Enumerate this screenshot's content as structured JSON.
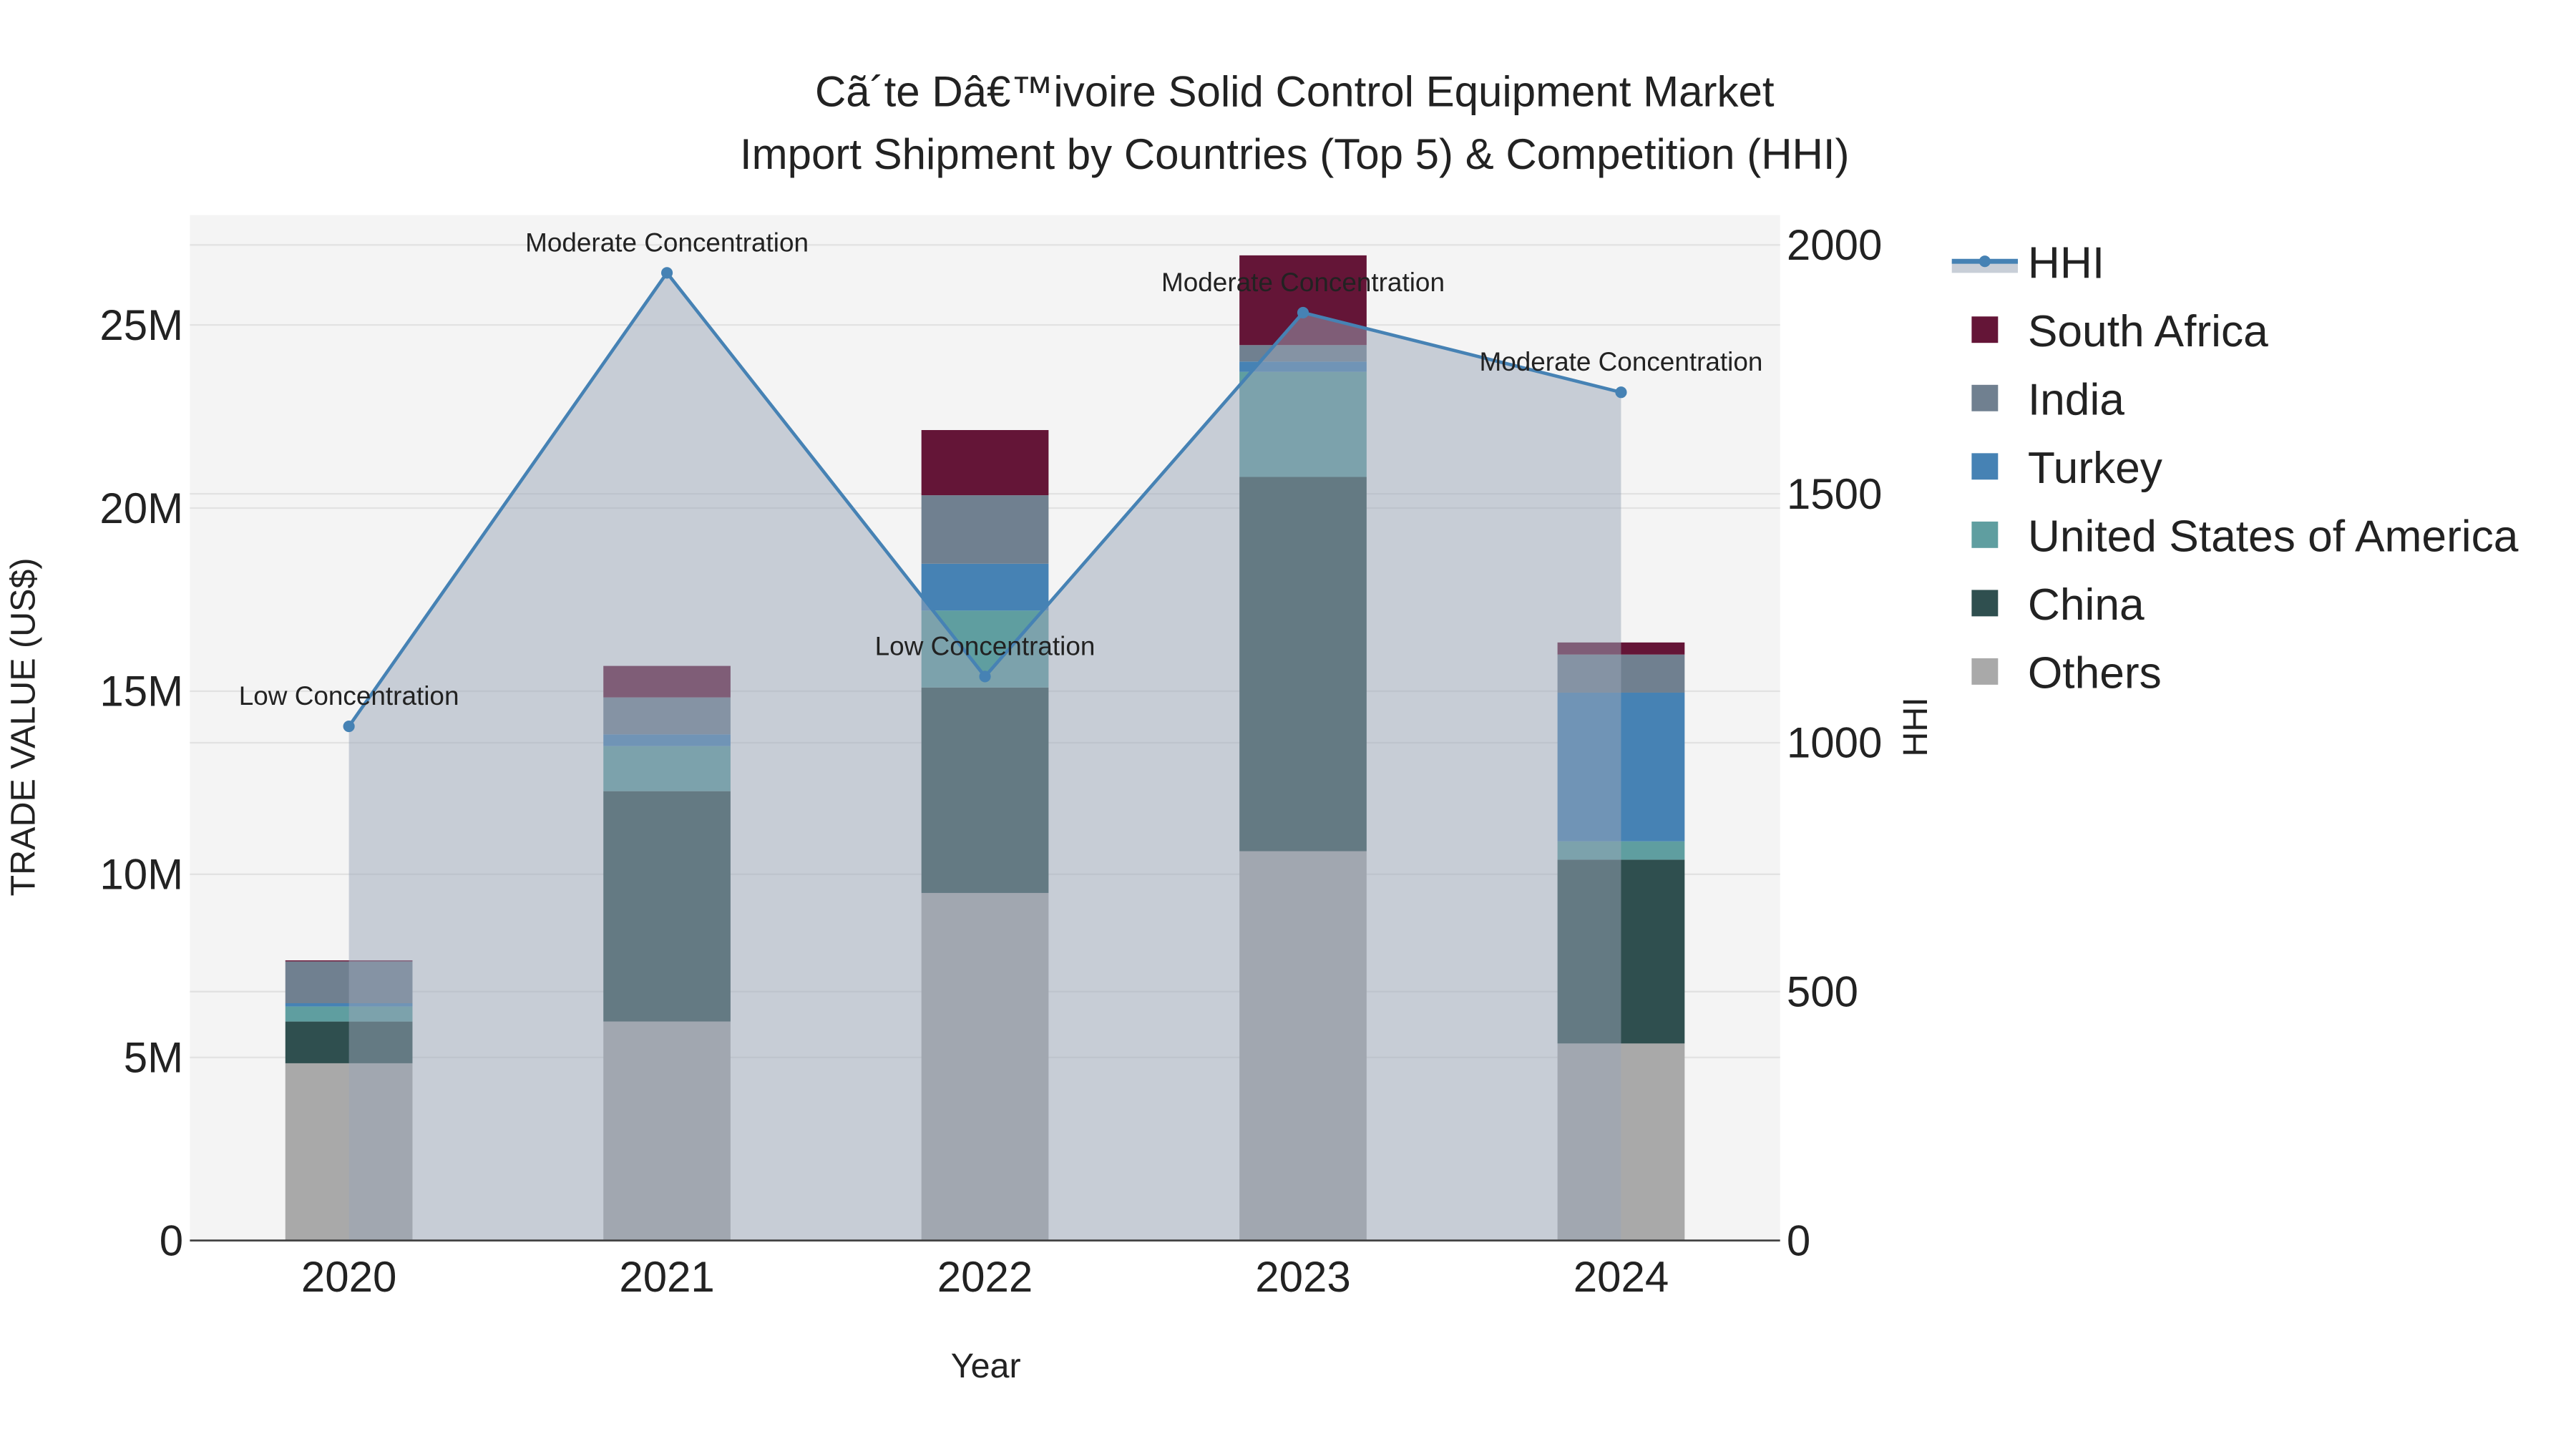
{
  "chart_data": {
    "type": "bar",
    "title_line1": "Cã´te Dâ€™ivoire Solid Control Equipment Market",
    "title_line2": "Import Shipment by Countries (Top 5) & Competition (HHI)",
    "xlabel": "Year",
    "ylabel": "TRADE VALUE (US$)",
    "y2label": "HHI",
    "categories": [
      "2020",
      "2021",
      "2022",
      "2023",
      "2024"
    ],
    "ylim": [
      0,
      28000000
    ],
    "y_ticks": [
      0,
      5000000,
      10000000,
      15000000,
      20000000,
      25000000
    ],
    "y_tick_labels": [
      "0",
      "5M",
      "10M",
      "15M",
      "20M",
      "25M"
    ],
    "y2lim": [
      0,
      2060
    ],
    "y2_ticks": [
      0,
      500,
      1000,
      1500,
      2000
    ],
    "y2_tick_labels": [
      "0",
      "500",
      "1000",
      "1500",
      "2000"
    ],
    "grid": true,
    "legend_position": "right",
    "series": [
      {
        "name": "Others",
        "color": "#a9a9a9",
        "values": [
          4840000,
          5980000,
          9490000,
          10630000,
          5380000
        ]
      },
      {
        "name": "China",
        "color": "#2f4f4f",
        "values": [
          1140000,
          6290000,
          5610000,
          10220000,
          5020000
        ]
      },
      {
        "name": "United States of America",
        "color": "#5f9ea0",
        "values": [
          410000,
          1230000,
          2100000,
          2870000,
          500000
        ]
      },
      {
        "name": "Turkey",
        "color": "#4682b4",
        "values": [
          90000,
          320000,
          1280000,
          280000,
          4060000
        ]
      },
      {
        "name": "India",
        "color": "#708090",
        "values": [
          1140000,
          1010000,
          1870000,
          450000,
          1040000
        ]
      },
      {
        "name": "South Africa",
        "color": "#641537",
        "values": [
          30000,
          860000,
          1780000,
          2450000,
          330000
        ]
      }
    ],
    "hhi": {
      "name": "HHI",
      "color": "#4682b4",
      "values": [
        1033,
        1944,
        1133,
        1864,
        1704
      ],
      "annotations": [
        "Low Concentration",
        "Moderate Concentration",
        "Low Concentration",
        "Moderate Concentration",
        "Moderate Concentration"
      ]
    },
    "legend_order": [
      "HHI",
      "South Africa",
      "India",
      "Turkey",
      "United States of America",
      "China",
      "Others"
    ]
  }
}
